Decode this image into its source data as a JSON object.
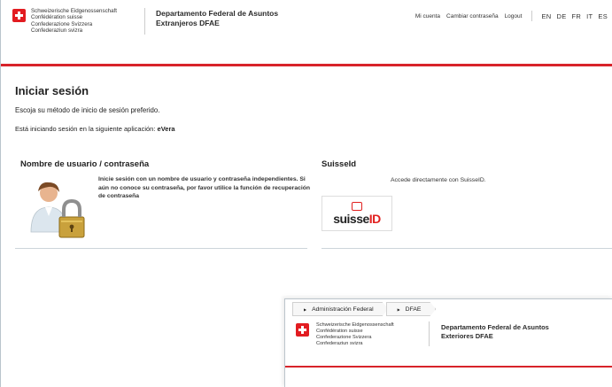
{
  "header": {
    "confederation": [
      "Schweizerische Eidgenossenschaft",
      "Confédération suisse",
      "Confederazione Svizzera",
      "Confederaziun svizra"
    ],
    "department": [
      "Departamento Federal de Asuntos",
      "Extranjeros DFAE"
    ],
    "links": [
      "Mi cuenta",
      "Cambiar contraseña",
      "Logout"
    ],
    "languages": [
      "EN",
      "DE",
      "FR",
      "IT",
      "ES"
    ]
  },
  "main": {
    "title": "Iniciar sesión",
    "subtitle": "Escoja su método de inicio de sesión preferido.",
    "app_prefix": "Está iniciando sesión en la siguiente aplicación:",
    "app_name": "eVera"
  },
  "login_user": {
    "title": "Nombre de usuario / contraseña",
    "text": "Inicie sesión con un nombre de usuario y contraseña independientes. Si aún no conoce su contraseña, por favor utilice la función de recuperación de contraseña"
  },
  "login_suisseid": {
    "title": "SuisseId",
    "text": "Accede directamente con SuisseID.",
    "logo_left": "suisse",
    "logo_right": "ID"
  },
  "overlay": {
    "breadcrumbs": [
      "Administración Federal",
      "DFAE"
    ],
    "confederation": [
      "Schweizerische Eidgenossenschaft",
      "Confédération suisse",
      "Confederazione Svizzera",
      "Confederaziun svizra"
    ],
    "department": [
      "Departamento Federal de Asuntos",
      "Exteriores DFAE"
    ]
  },
  "colors": {
    "red": "#d8232a"
  }
}
